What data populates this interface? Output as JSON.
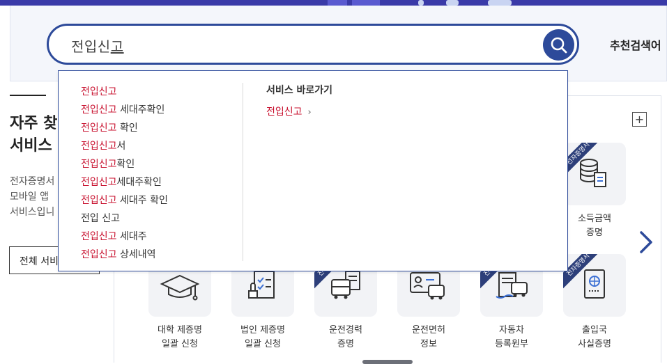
{
  "search": {
    "query_main": "전입신",
    "query_composing": "고",
    "recommend_label": "추천검색어"
  },
  "sidebar": {
    "title": "자주 찾\n서비스",
    "description": "전자증명서\n모바일 앱\n서비스입니",
    "all_button": "전체 서비스"
  },
  "dropdown": {
    "suggestions": [
      {
        "kw": "전입신고",
        "rest": ""
      },
      {
        "kw": "전입신고",
        "rest": " 세대주확인"
      },
      {
        "kw": "전입신고",
        "rest": " 확인"
      },
      {
        "kw": "전입신고",
        "rest": "서"
      },
      {
        "kw": "전입신고",
        "rest": "확인"
      },
      {
        "kw": "전입신고",
        "rest": "세대주확인"
      },
      {
        "kw": "전입신고",
        "rest": " 세대주 확인"
      },
      {
        "kw": "",
        "rest": "전입 신고"
      },
      {
        "kw": "전입신고",
        "rest": " 세대주"
      },
      {
        "kw": "전입신고",
        "rest": " 상세내역"
      }
    ],
    "shortcut_title": "서비스 바로가기",
    "shortcut_link": "전입신고",
    "shortcut_chevron": "›"
  },
  "services": {
    "plus_label": "+",
    "ribbon_label": "전자증명서",
    "items": [
      {
        "label": "소득금액\n증명",
        "icon": "database-document-icon",
        "ribbon": true
      },
      {
        "label": "대학 제증명\n일괄 신청",
        "icon": "graduation-cap-icon",
        "ribbon": false
      },
      {
        "label": "법인 제증명\n일괄 신청",
        "icon": "checklist-stamp-icon",
        "ribbon": false
      },
      {
        "label": "운전경력\n증명",
        "icon": "bus-document-icon",
        "ribbon": true
      },
      {
        "label": "운전면허\n정보",
        "icon": "license-card-car-icon",
        "ribbon": false
      },
      {
        "label": "자동차\n등록원부",
        "icon": "car-register-icon",
        "ribbon": true
      },
      {
        "label": "출입국\n사실증명",
        "icon": "passport-icon",
        "ribbon": true
      }
    ]
  },
  "colors": {
    "accent": "#2d4a9a",
    "keyword": "#c8102e",
    "ribbon": "#2d3f7a"
  }
}
